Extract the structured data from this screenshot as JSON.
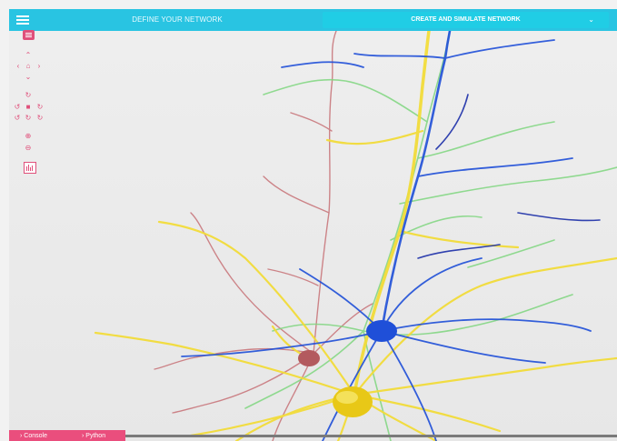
{
  "header": {
    "define_tab": "DEFINE YOUR NETWORK",
    "create_tab": "CREATE AND SIMULATE NETWORK",
    "expand_icon": "chevron-down"
  },
  "colors": {
    "topbar": "#29c4e2",
    "accent": "#e0507b",
    "neuron_blue": "#1f4fd8",
    "neuron_yellow": "#f2dc3a",
    "neuron_green": "#7fd67f",
    "neuron_red": "#c9787d",
    "neuron_navy": "#1c2fa8"
  },
  "toolbar": {
    "icons": [
      "list-icon",
      "pan-up-icon",
      "pan-left-icon",
      "home-icon",
      "pan-right-icon",
      "pan-down-icon",
      "rotate-icon",
      "rotate-left-icon",
      "camera-icon",
      "rotate-right-icon",
      "rotate-ccw-icon",
      "rotate-cw-icon",
      "rotate-cw-alt-icon",
      "zoom-in-icon",
      "zoom-out-icon",
      "histogram-icon"
    ]
  },
  "bottom": {
    "console_label": "Console",
    "python_label": "Python",
    "console_prefix": "›",
    "python_prefix": "›"
  }
}
